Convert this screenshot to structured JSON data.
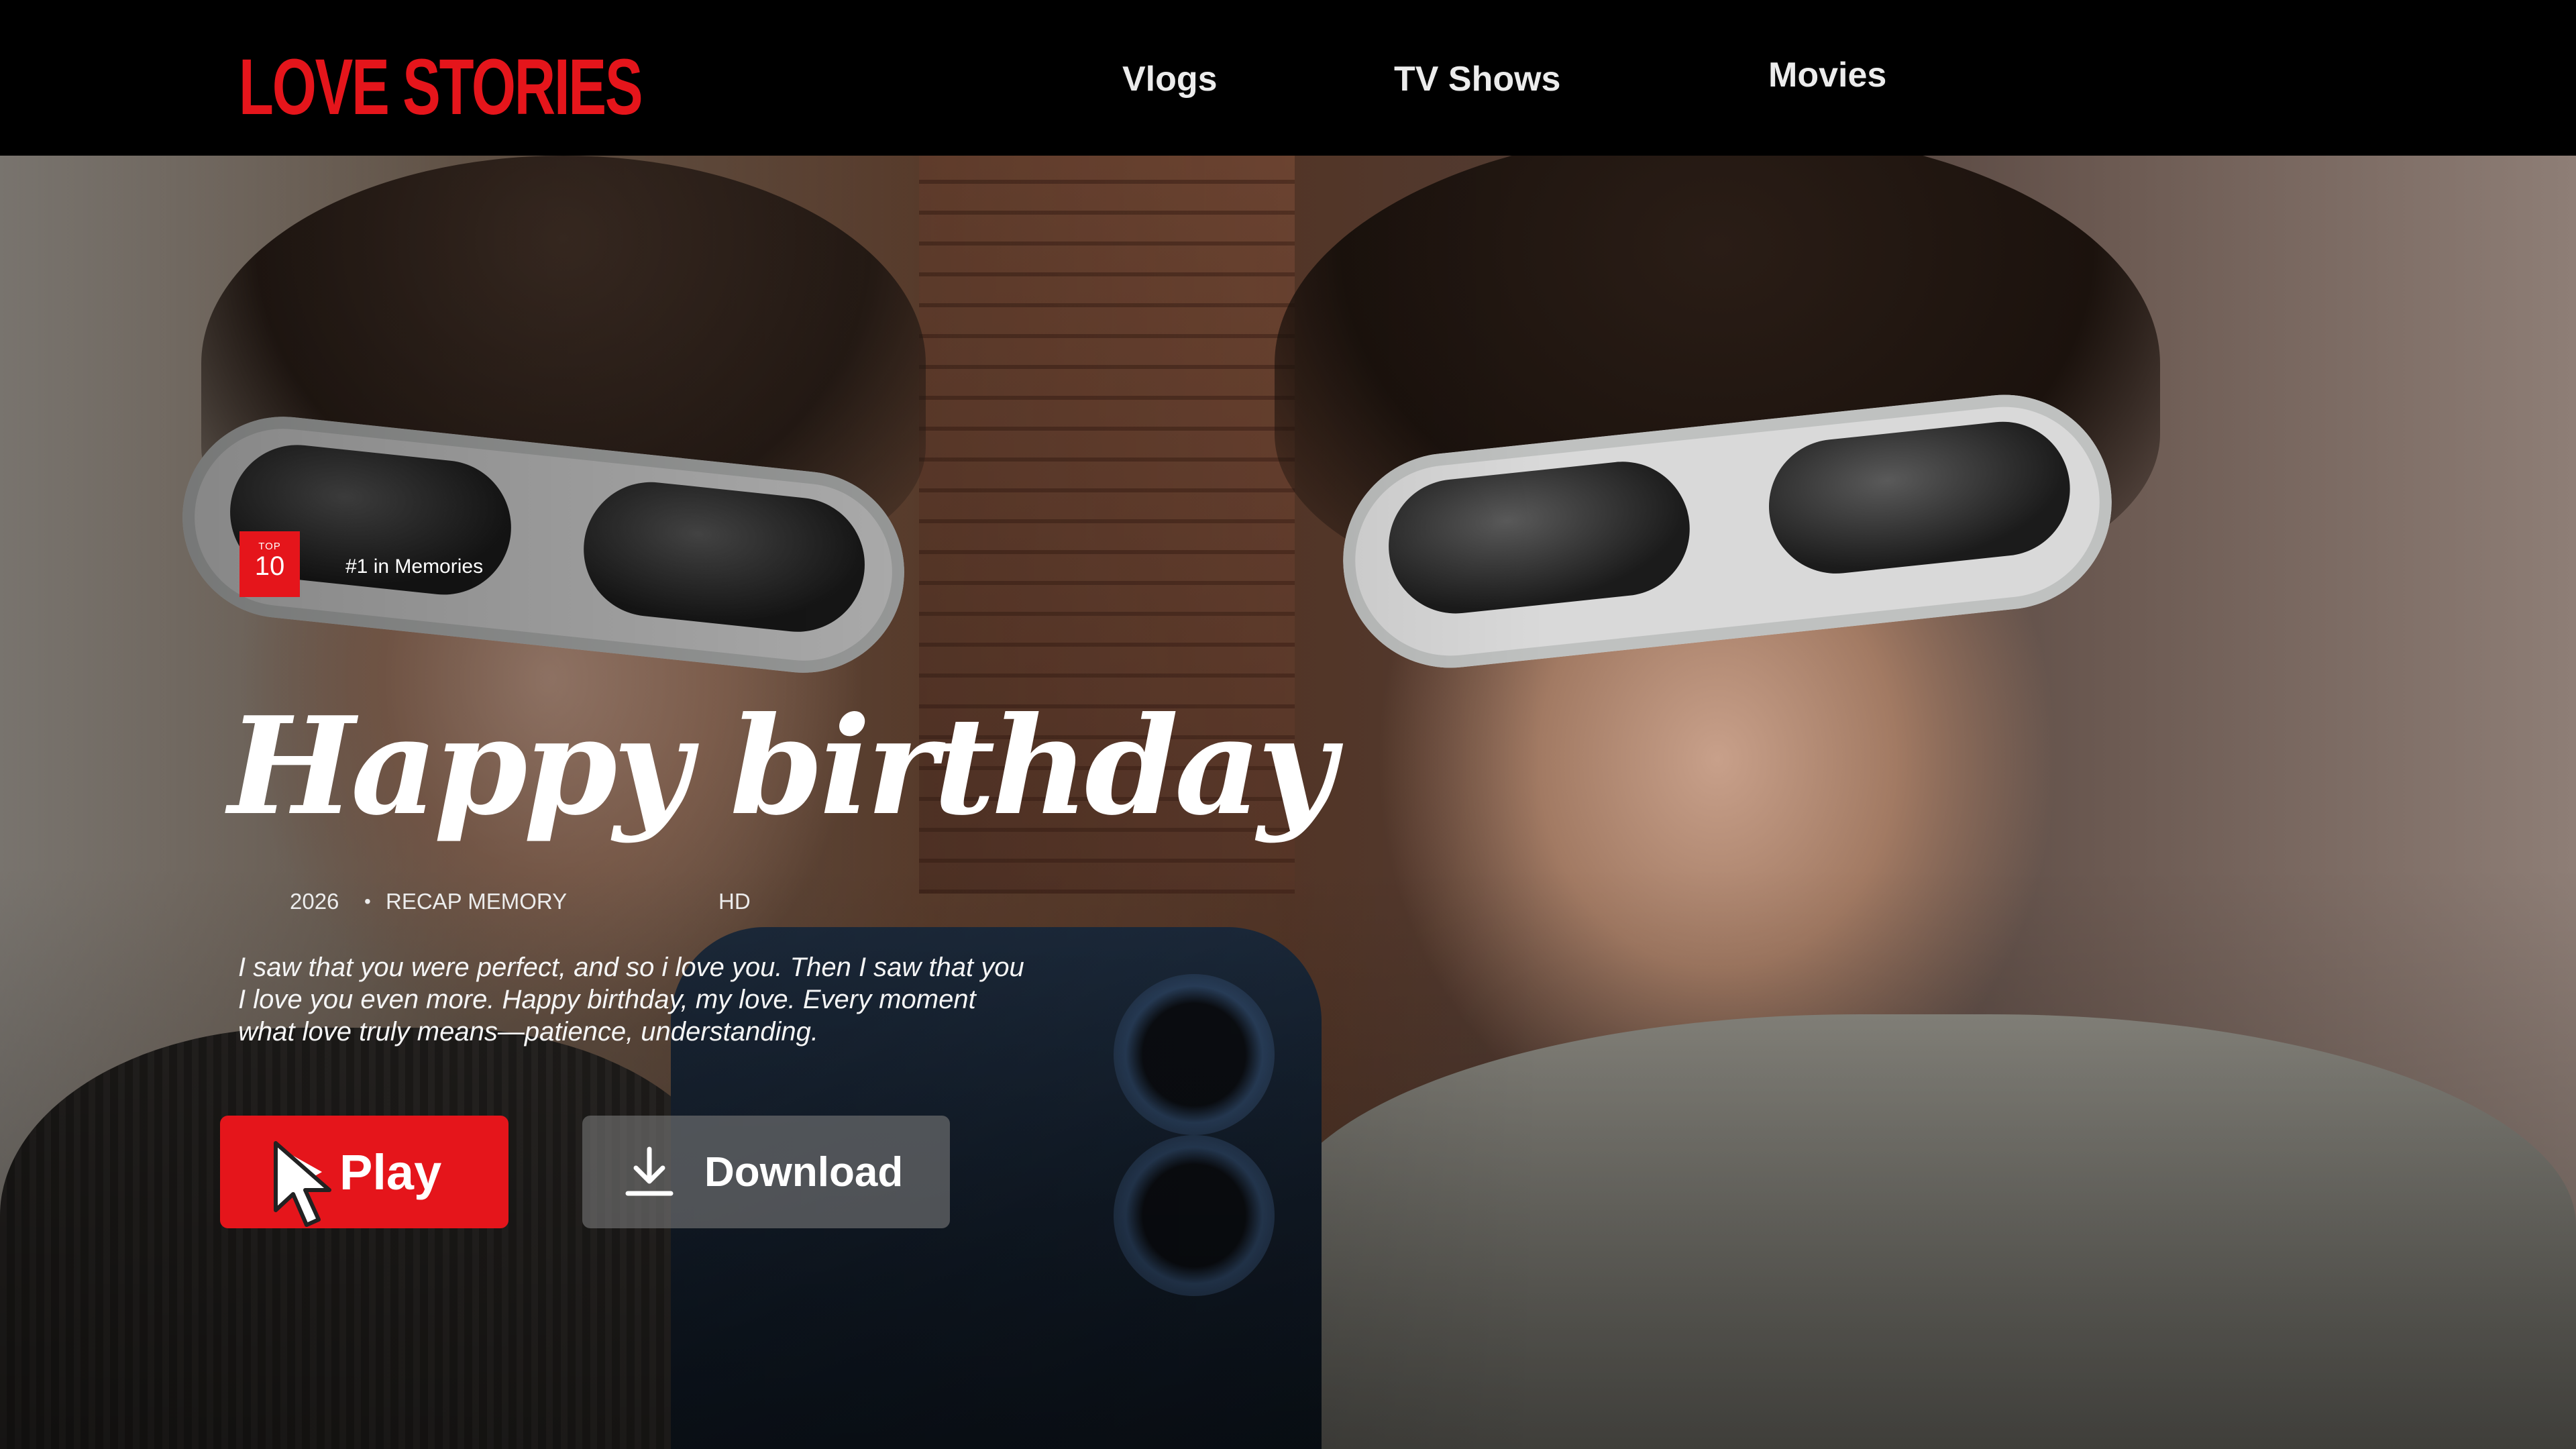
{
  "header": {
    "brand": "LOVE STORIES",
    "nav": [
      {
        "label": "Vlogs"
      },
      {
        "label": "TV Shows"
      },
      {
        "label": "Movies"
      }
    ]
  },
  "hero": {
    "badge": {
      "small": "TOP",
      "big": "10"
    },
    "rank_text": "#1 in Memories",
    "title": "Happy birthday",
    "meta": {
      "year": "2026",
      "separator": "•",
      "category": "RECAP MEMORY",
      "quality": "HD"
    },
    "description_lines": [
      "I saw that you were perfect, and so i love you. Then I saw that you",
      "I love you even more. Happy birthday, my love. Every moment",
      "what love truly means—patience, understanding."
    ],
    "buttons": {
      "play": "Play",
      "download": "Download"
    }
  },
  "colors": {
    "brand_red": "#e5151b",
    "header_bg": "#000000",
    "download_bg": "rgba(120,120,120,0.62)"
  },
  "icons": [
    "play-icon",
    "download-icon",
    "mouse-cursor-icon"
  ]
}
